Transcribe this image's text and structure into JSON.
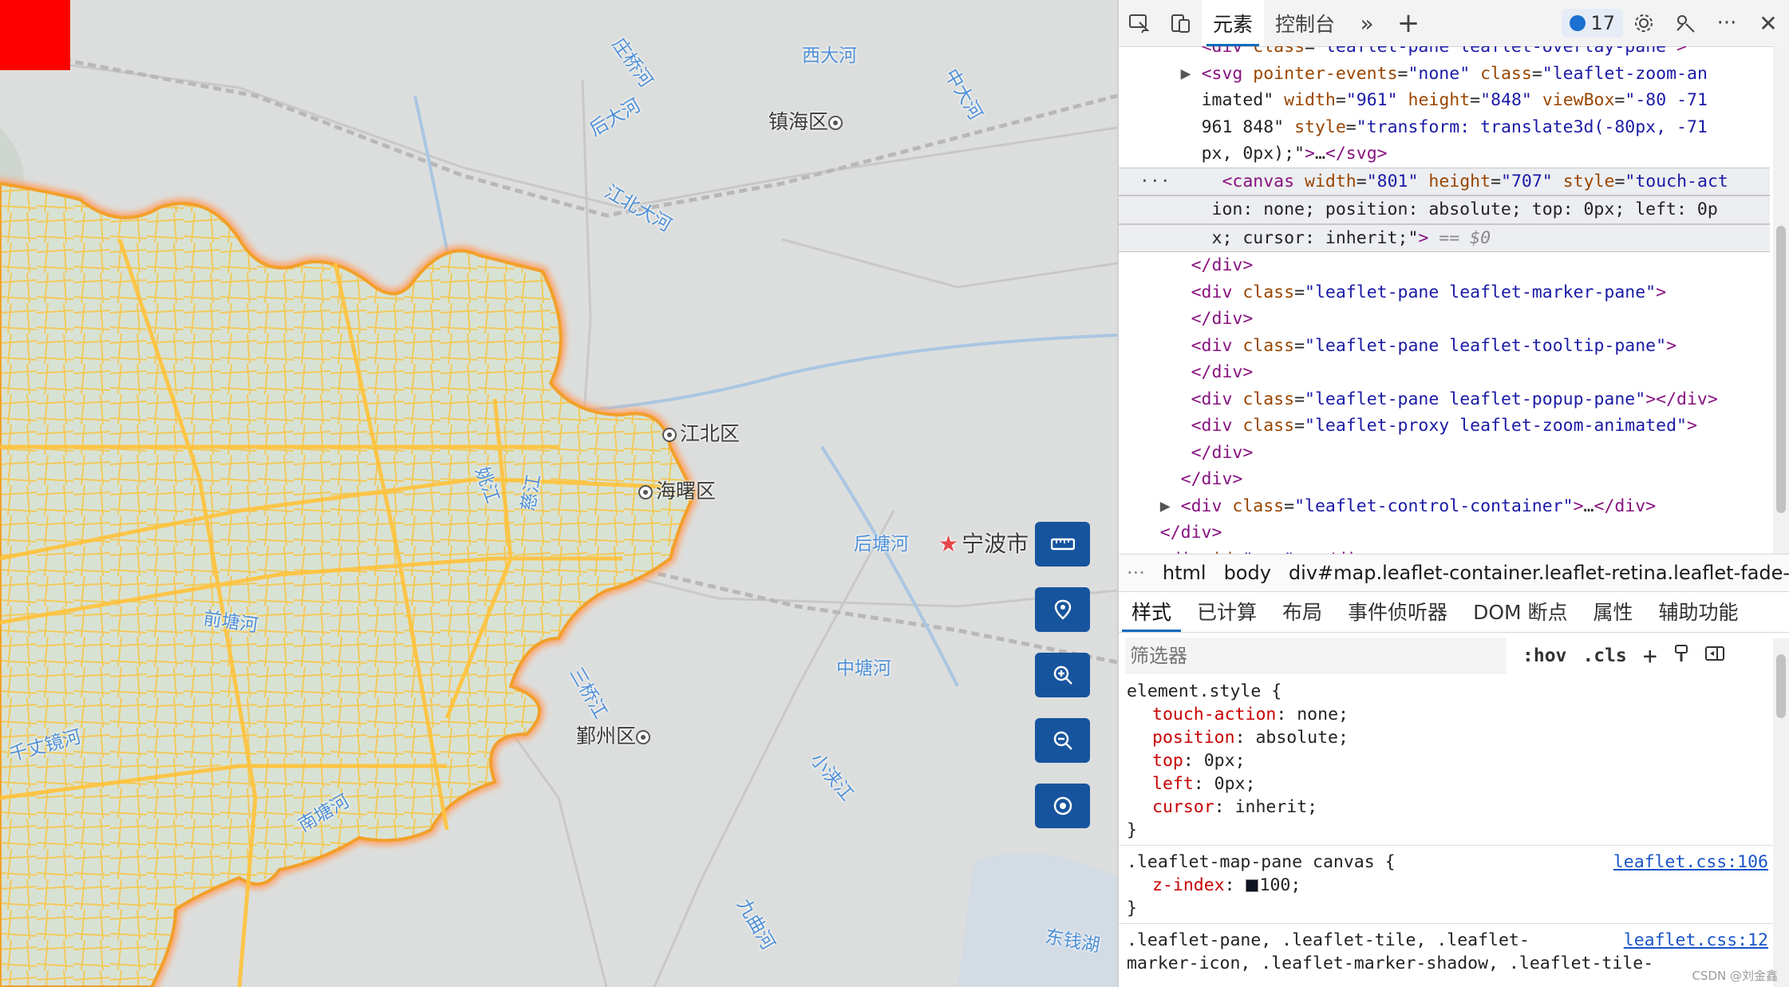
{
  "map": {
    "labels": [
      {
        "text": "镇海区",
        "kind": "district"
      },
      {
        "text": "江北区",
        "kind": "district"
      },
      {
        "text": "海曙区",
        "kind": "district"
      },
      {
        "text": "鄞州区",
        "kind": "district"
      },
      {
        "text": "宁波市",
        "kind": "city"
      }
    ],
    "rivers": [
      "西大河",
      "庄桥河",
      "后大河",
      "中大河",
      "姚江",
      "江北大河",
      "中塘河",
      "后塘河",
      "慈江",
      "三桥江",
      "南塘河",
      "小浃江",
      "千丈镜河",
      "前塘河",
      "九曲河",
      "东钱湖"
    ],
    "controls": [
      {
        "name": "measure",
        "icon": "ruler-icon"
      },
      {
        "name": "location",
        "icon": "location-pin-icon"
      },
      {
        "name": "zoom-in",
        "icon": "zoom-in-icon"
      },
      {
        "name": "zoom-out",
        "icon": "zoom-out-icon"
      },
      {
        "name": "locate",
        "icon": "target-icon"
      }
    ],
    "colors": {
      "roads": "#ffc94d",
      "boundary": "#ff9a5c",
      "control_bg": "#17549e",
      "marker": "#ff0000"
    }
  },
  "devtools": {
    "toolbar": {
      "tab_elements": "元素",
      "tab_console": "控制台",
      "issues_count": "17"
    },
    "dom_lines": [
      {
        "indent": "        ",
        "html": "&lt;div class=\"leaflet-pane leaflet-overlay-pane\"&gt;"
      },
      {
        "indent": "      ▶ ",
        "html": "&lt;svg pointer-events=\"none\" class=\"leaflet-zoom-an"
      },
      {
        "indent": "        ",
        "html": "imated\" width=\"961\" height=\"848\" viewBox=\"-80 -71"
      },
      {
        "indent": "        ",
        "html": "961 848\" style=\"transform: translate3d(-80px, -71"
      },
      {
        "indent": "        ",
        "html": "px, 0px);\"&gt;…&lt;/svg&gt;"
      },
      {
        "indent": "  ···     ",
        "html": "&lt;canvas width=\"801\" height=\"707\" style=\"touch-act",
        "selected": true
      },
      {
        "indent": "         ",
        "html": "ion: none; position: absolute; top: 0px; left: 0p",
        "selected": true
      },
      {
        "indent": "         ",
        "html": "x; cursor: inherit;\"&gt; == $0",
        "selected": true
      },
      {
        "indent": "       ",
        "html": "&lt;/div&gt;"
      },
      {
        "indent": "       ",
        "html": "&lt;div class=\"leaflet-pane leaflet-marker-pane\"&gt;"
      },
      {
        "indent": "       ",
        "html": "&lt;/div&gt;"
      },
      {
        "indent": "       ",
        "html": "&lt;div class=\"leaflet-pane leaflet-tooltip-pane\"&gt;"
      },
      {
        "indent": "       ",
        "html": "&lt;/div&gt;"
      },
      {
        "indent": "       ",
        "html": "&lt;div class=\"leaflet-pane leaflet-popup-pane\"&gt;&lt;/div&gt;"
      },
      {
        "indent": "       ",
        "html": "&lt;div class=\"leaflet-proxy leaflet-zoom-animated\"&gt;"
      },
      {
        "indent": "       ",
        "html": "&lt;/div&gt;"
      },
      {
        "indent": "      ",
        "html": "&lt;/div&gt;"
      },
      {
        "indent": "    ▶ ",
        "html": "&lt;div class=\"leaflet-control-container\"&gt;…&lt;/div&gt;"
      },
      {
        "indent": "    ",
        "html": "&lt;/div&gt;"
      },
      {
        "indent": "  ▶ ",
        "html": "&lt;div id=\"app\"&gt;…&lt;/div&gt;"
      }
    ],
    "breadcrumb": [
      "···",
      "html",
      "body",
      "div#map.leaflet-container.leaflet-retina.leaflet-fade-a"
    ],
    "panel_tabs": [
      "样式",
      "已计算",
      "布局",
      "事件侦听器",
      "DOM 断点",
      "属性",
      "辅助功能"
    ],
    "filter": {
      "placeholder": "筛选器",
      "hov": ":hov",
      "cls": ".cls"
    },
    "styles": {
      "element_selector": "element.style {",
      "element_props": [
        {
          "name": "touch-action",
          "value": "none;"
        },
        {
          "name": "position",
          "value": "absolute;"
        },
        {
          "name": "top",
          "value": "0px;"
        },
        {
          "name": "left",
          "value": "0px;"
        },
        {
          "name": "cursor",
          "value": "inherit;"
        }
      ],
      "rule2_selector": ".leaflet-map-pane canvas {",
      "rule2_source": "leaflet.css:106",
      "rule2_prop": {
        "name": "z-index",
        "value": "100;"
      },
      "rule3_selector": ".leaflet-pane, .leaflet-tile, .leaflet-",
      "rule3_selector2": "marker-icon, .leaflet-marker-shadow, .leaflet-tile-",
      "rule3_source": "leaflet.css:12",
      "close_brace": "}"
    },
    "watermark": "CSDN @刘金鑫"
  }
}
